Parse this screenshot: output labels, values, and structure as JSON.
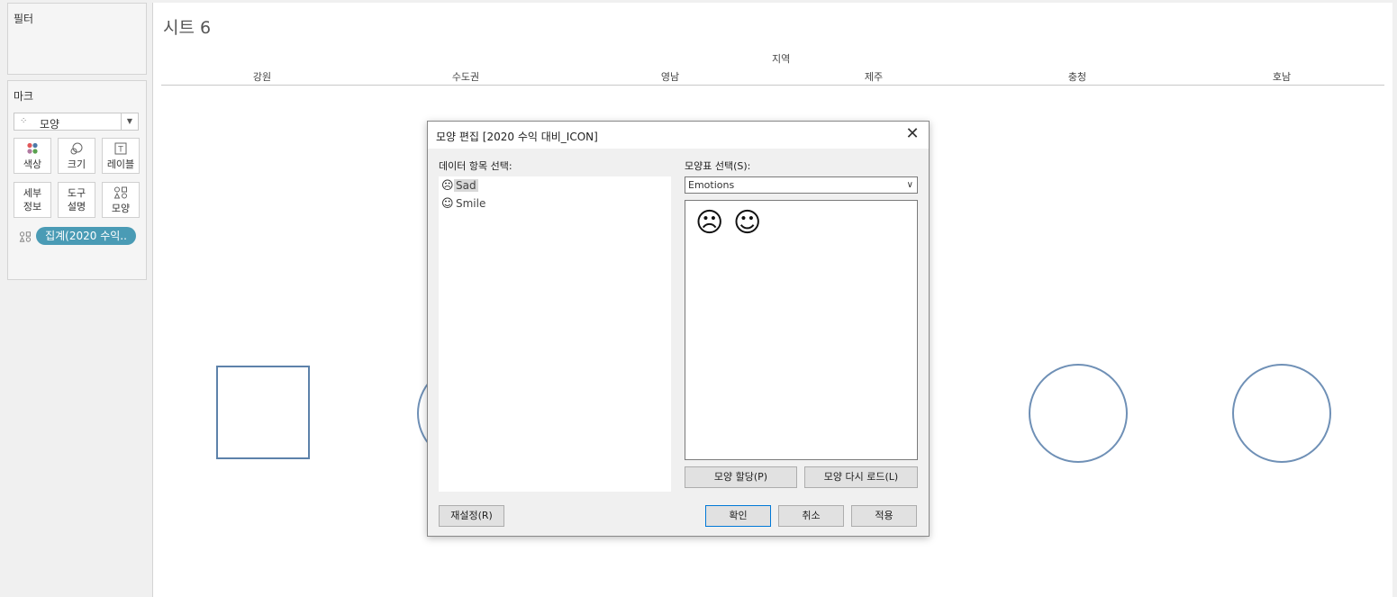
{
  "filters": {
    "title": "필터"
  },
  "marks": {
    "title": "마크",
    "type_icon": "shapes-icon",
    "type_label": "모양",
    "buttons": {
      "color": "색상",
      "size": "크기",
      "label": "레이블",
      "detail_line1": "세부",
      "detail_line2": "정보",
      "tooltip_line1": "도구",
      "tooltip_line2": "설명",
      "shape": "모양"
    },
    "pill_label": "집계(2020 수익.."
  },
  "sheet": {
    "title": "시트 6",
    "region_header": "지역",
    "columns": [
      "강원",
      "수도권",
      "영남",
      "제주",
      "충청",
      "호남"
    ]
  },
  "dialog": {
    "title": "모양 편집 [2020 수익 대비_ICON]",
    "close_label": "✕",
    "data_items_label": "데이터 항목 선택:",
    "data_items": [
      "Sad",
      "Smile"
    ],
    "palette_label": "모양표 선택(S):",
    "palette_value": "Emotions",
    "assign_button": "모양 할당(P)",
    "reload_button": "모양 다시 로드(L)",
    "reset_button": "재설정(R)",
    "ok_button": "확인",
    "cancel_button": "취소",
    "apply_button": "적용"
  }
}
